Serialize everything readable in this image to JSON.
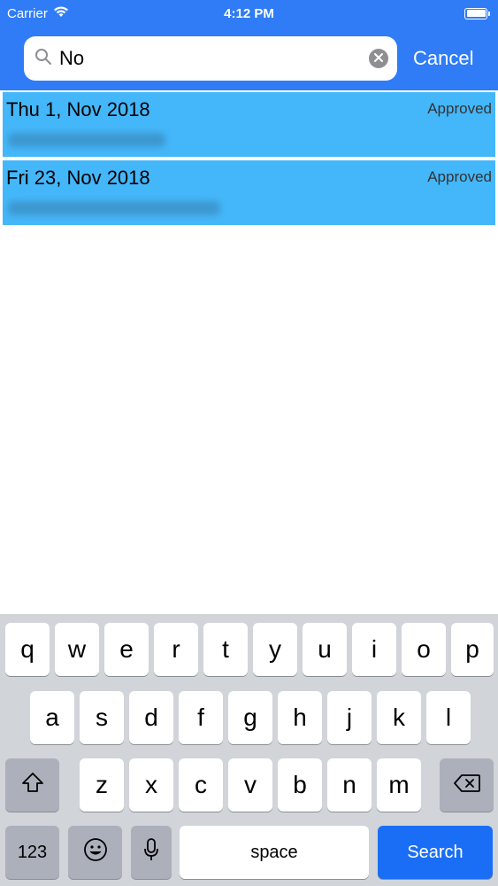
{
  "status_bar": {
    "carrier": "Carrier",
    "time": "4:12 PM"
  },
  "search": {
    "value": "No",
    "cancel_label": "Cancel"
  },
  "results": [
    {
      "date": "Thu 1, Nov 2018",
      "status": "Approved"
    },
    {
      "date": "Fri 23, Nov 2018",
      "status": "Approved"
    }
  ],
  "keyboard": {
    "row1": [
      "q",
      "w",
      "e",
      "r",
      "t",
      "y",
      "u",
      "i",
      "o",
      "p"
    ],
    "row2": [
      "a",
      "s",
      "d",
      "f",
      "g",
      "h",
      "j",
      "k",
      "l"
    ],
    "row3": [
      "z",
      "x",
      "c",
      "v",
      "b",
      "n",
      "m"
    ],
    "numbers_label": "123",
    "space_label": "space",
    "search_label": "Search"
  },
  "colors": {
    "header": "#2f7cf6",
    "row_highlight": "#44b7fa",
    "search_key": "#1a6ef5"
  }
}
